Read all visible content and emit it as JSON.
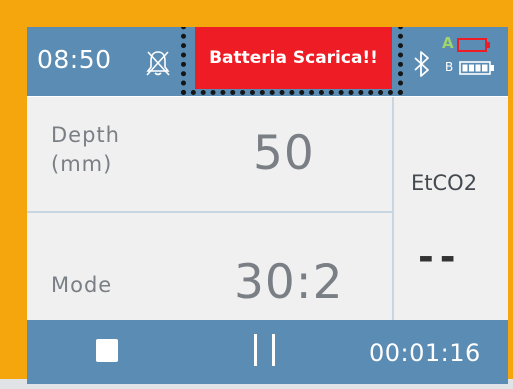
{
  "status_bar": {
    "time": "08:50",
    "alarm_icon": "alarm-muted-icon",
    "alert_text": "Batteria Scarica!!",
    "bluetooth_icon": "bluetooth-icon",
    "battery_a_label": "A",
    "battery_b_label": "B",
    "battery_a_level": 0.0,
    "battery_b_level": 1.0
  },
  "colors": {
    "background": "#f5a60d",
    "bar": "#5b8cb4",
    "alert": "#ee1c25",
    "panel": "#f0f0f0",
    "battery_a": "#ee1c25",
    "battery_b": "#ffffff"
  },
  "depth": {
    "label": "Depth",
    "unit": "(mm)",
    "value": "50"
  },
  "mode": {
    "label": "Mode",
    "value": "30:2"
  },
  "etco2": {
    "label": "EtCO2",
    "value": "--"
  },
  "bottom_bar": {
    "stop_icon": "stop-icon",
    "pause_icon": "pause-icon",
    "elapsed": "00:01:16"
  }
}
